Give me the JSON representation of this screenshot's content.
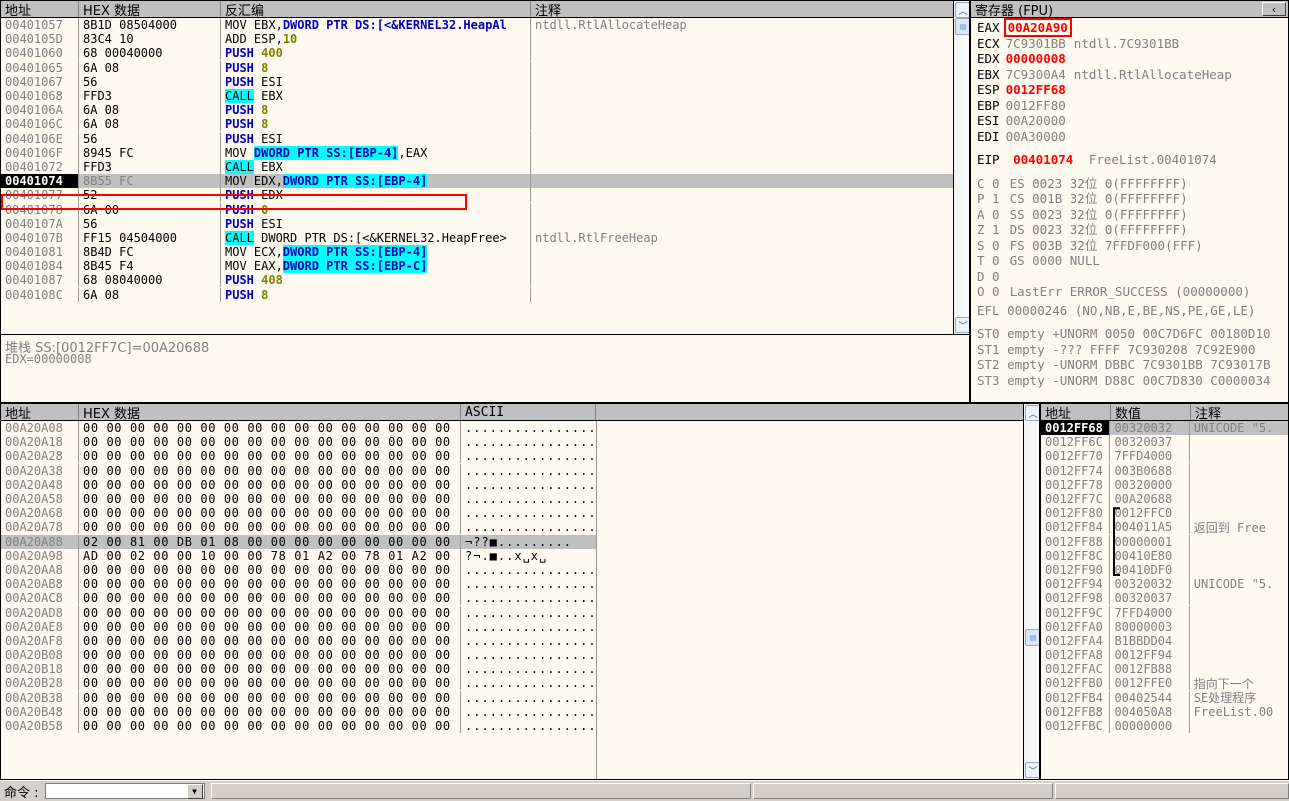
{
  "disassembly": {
    "headers": [
      "地址",
      "HEX 数据",
      "反汇编",
      "注释"
    ],
    "rows": [
      {
        "addr": "00401057",
        "hex": "8B1D 08504000",
        "dis": [
          {
            "t": "MOV ",
            "c": "mn-black"
          },
          {
            "t": "EBX,",
            "c": "mn-black"
          },
          {
            "t": "DWORD PTR DS:[<&KERNEL32.HeapAl",
            "c": "op-dkblue"
          }
        ],
        "cmt": "ntdll.RtlAllocateHeap"
      },
      {
        "addr": "0040105D",
        "hex": "83C4 10",
        "dis": [
          {
            "t": "ADD ",
            "c": "mn-black"
          },
          {
            "t": "ESP,",
            "c": "mn-black"
          },
          {
            "t": "10",
            "c": "num-olive"
          }
        ],
        "cmt": ""
      },
      {
        "addr": "00401060",
        "hex": "68 00040000",
        "dis": [
          {
            "t": "PUSH ",
            "c": "mn-blue"
          },
          {
            "t": "400",
            "c": "num-olive"
          }
        ],
        "cmt": ""
      },
      {
        "addr": "00401065",
        "hex": "6A 08",
        "dis": [
          {
            "t": "PUSH ",
            "c": "mn-blue"
          },
          {
            "t": "8",
            "c": "num-olive"
          }
        ],
        "cmt": ""
      },
      {
        "addr": "00401067",
        "hex": "56",
        "dis": [
          {
            "t": "PUSH ",
            "c": "mn-blue"
          },
          {
            "t": "ESI",
            "c": "mn-black"
          }
        ],
        "cmt": ""
      },
      {
        "addr": "00401068",
        "hex": "FFD3",
        "dis": [
          {
            "t": "CALL",
            "c": "cyan"
          },
          {
            "t": " EBX",
            "c": "mn-black"
          }
        ],
        "cmt": ""
      },
      {
        "addr": "0040106A",
        "hex": "6A 08",
        "dis": [
          {
            "t": "PUSH ",
            "c": "mn-blue"
          },
          {
            "t": "8",
            "c": "num-olive"
          }
        ],
        "cmt": ""
      },
      {
        "addr": "0040106C",
        "hex": "6A 08",
        "dis": [
          {
            "t": "PUSH ",
            "c": "mn-blue"
          },
          {
            "t": "8",
            "c": "num-olive"
          }
        ],
        "cmt": ""
      },
      {
        "addr": "0040106E",
        "hex": "56",
        "dis": [
          {
            "t": "PUSH ",
            "c": "mn-blue"
          },
          {
            "t": "ESI",
            "c": "mn-black"
          }
        ],
        "cmt": ""
      },
      {
        "addr": "0040106F",
        "hex": "8945 FC",
        "dis": [
          {
            "t": "MOV ",
            "c": "mn-black"
          },
          {
            "t": "DWORD PTR SS:[EBP-4]",
            "c": "cyan-b"
          },
          {
            "t": ",EAX",
            "c": "mn-black"
          }
        ],
        "cmt": ""
      },
      {
        "addr": "00401072",
        "hex": "FFD3",
        "dis": [
          {
            "t": "CALL",
            "c": "cyan"
          },
          {
            "t": " EBX",
            "c": "mn-black"
          }
        ],
        "cmt": ""
      },
      {
        "addr": "00401074",
        "hex": "8B55 FC",
        "dis": [
          {
            "t": "MOV EDX,",
            "c": "mn-black"
          },
          {
            "t": "DWORD PTR SS:[EBP-4]",
            "c": "cyan-b"
          }
        ],
        "cmt": "",
        "current": true
      },
      {
        "addr": "00401077",
        "hex": "52",
        "dis": [
          {
            "t": "PUSH ",
            "c": "mn-blue"
          },
          {
            "t": "EDX",
            "c": "mn-black"
          }
        ],
        "cmt": ""
      },
      {
        "addr": "00401078",
        "hex": "6A 00",
        "dis": [
          {
            "t": "PUSH ",
            "c": "mn-blue"
          },
          {
            "t": "0",
            "c": "num-olive"
          }
        ],
        "cmt": ""
      },
      {
        "addr": "0040107A",
        "hex": "56",
        "dis": [
          {
            "t": "PUSH ",
            "c": "mn-blue"
          },
          {
            "t": "ESI",
            "c": "mn-black"
          }
        ],
        "cmt": ""
      },
      {
        "addr": "0040107B",
        "hex": "FF15 04504000",
        "dis": [
          {
            "t": "CALL",
            "c": "cyan"
          },
          {
            "t": " DWORD PTR DS:[<&KERNEL32.HeapFree>",
            "c": "mn-black"
          }
        ],
        "cmt": "ntdll.RtlFreeHeap"
      },
      {
        "addr": "00401081",
        "hex": "8B4D FC",
        "dis": [
          {
            "t": "MOV ECX,",
            "c": "mn-black"
          },
          {
            "t": "DWORD PTR SS:[EBP-4]",
            "c": "cyan-b"
          }
        ],
        "cmt": ""
      },
      {
        "addr": "00401084",
        "hex": "8B45 F4",
        "dis": [
          {
            "t": "MOV EAX,",
            "c": "mn-black"
          },
          {
            "t": "DWORD PTR SS:[EBP-C]",
            "c": "cyan-b"
          }
        ],
        "cmt": ""
      },
      {
        "addr": "00401087",
        "hex": "68 08040000",
        "dis": [
          {
            "t": "PUSH ",
            "c": "mn-blue"
          },
          {
            "t": "408",
            "c": "num-olive"
          }
        ],
        "cmt": ""
      },
      {
        "addr": "0040108C",
        "hex": "6A 08",
        "dis": [
          {
            "t": "PUSH ",
            "c": "mn-blue"
          },
          {
            "t": "8",
            "c": "num-olive"
          }
        ],
        "cmt": ""
      }
    ]
  },
  "stack_info": {
    "line1": "堆栈 SS:[0012FF7C]=00A20688",
    "line2": "EDX=00000008"
  },
  "registers": {
    "title": "寄存器 (FPU)",
    "collapse_icon": "‹",
    "gpr": [
      {
        "name": "EAX",
        "value": "00A20A90",
        "cmt": "",
        "hl": true,
        "red": true
      },
      {
        "name": "ECX",
        "value": "7C9301BB",
        "cmt": "ntdll.7C9301BB",
        "red": false
      },
      {
        "name": "EDX",
        "value": "00000008",
        "cmt": "",
        "red": true
      },
      {
        "name": "EBX",
        "value": "7C9300A4",
        "cmt": "ntdll.RtlAllocateHeap",
        "red": false
      },
      {
        "name": "ESP",
        "value": "0012FF68",
        "cmt": "",
        "red": true
      },
      {
        "name": "EBP",
        "value": "0012FF80",
        "cmt": "",
        "red": false
      },
      {
        "name": "ESI",
        "value": "00A20000",
        "cmt": "",
        "red": false
      },
      {
        "name": "EDI",
        "value": "00A30000",
        "cmt": "",
        "red": false
      }
    ],
    "eip": {
      "name": "EIP",
      "value": "00401074",
      "cmt": "FreeList.00401074"
    },
    "flags": [
      {
        "f": "C",
        "v": "0",
        "seg": "ES",
        "sval": "0023",
        "desc": "32位  0(FFFFFFFF)"
      },
      {
        "f": "P",
        "v": "1",
        "seg": "CS",
        "sval": "001B",
        "desc": "32位  0(FFFFFFFF)"
      },
      {
        "f": "A",
        "v": "0",
        "seg": "SS",
        "sval": "0023",
        "desc": "32位  0(FFFFFFFF)"
      },
      {
        "f": "Z",
        "v": "1",
        "seg": "DS",
        "sval": "0023",
        "desc": "32位  0(FFFFFFFF)"
      },
      {
        "f": "S",
        "v": "0",
        "seg": "FS",
        "sval": "003B",
        "desc": "32位  7FFDF000(FFF)"
      },
      {
        "f": "T",
        "v": "0",
        "seg": "GS",
        "sval": "0000",
        "desc": "NULL"
      },
      {
        "f": "D",
        "v": "0",
        "seg": "",
        "sval": "",
        "desc": ""
      },
      {
        "f": "O",
        "v": "0",
        "seg": "",
        "sval": "",
        "desc": "LastErr ERROR_SUCCESS (00000000)"
      }
    ],
    "efl": "EFL 00000246 (NO,NB,E,BE,NS,PE,GE,LE)",
    "fpu": [
      "ST0 empty +UNORM 0050 00C7D6FC 00180D10",
      "ST1 empty -??? FFFF 7C930208 7C92E900",
      "ST2 empty -UNORM DBBC 7C9301BB 7C93017B",
      "ST3 empty -UNORM D88C 00C7D830 C0000034"
    ]
  },
  "dump": {
    "headers": [
      "地址",
      "HEX 数据",
      "ASCII",
      ""
    ],
    "rows": [
      {
        "addr": "00A20A08",
        "bytes": "00 00 00 00 00 00 00 00 00 00 00 00 00 00 00 00",
        "ascii": "................"
      },
      {
        "addr": "00A20A18",
        "bytes": "00 00 00 00 00 00 00 00 00 00 00 00 00 00 00 00",
        "ascii": "................"
      },
      {
        "addr": "00A20A28",
        "bytes": "00 00 00 00 00 00 00 00 00 00 00 00 00 00 00 00",
        "ascii": "................"
      },
      {
        "addr": "00A20A38",
        "bytes": "00 00 00 00 00 00 00 00 00 00 00 00 00 00 00 00",
        "ascii": "................"
      },
      {
        "addr": "00A20A48",
        "bytes": "00 00 00 00 00 00 00 00 00 00 00 00 00 00 00 00",
        "ascii": "................"
      },
      {
        "addr": "00A20A58",
        "bytes": "00 00 00 00 00 00 00 00 00 00 00 00 00 00 00 00",
        "ascii": "................"
      },
      {
        "addr": "00A20A68",
        "bytes": "00 00 00 00 00 00 00 00 00 00 00 00 00 00 00 00",
        "ascii": "................"
      },
      {
        "addr": "00A20A78",
        "bytes": "00 00 00 00 00 00 00 00 00 00 00 00 00 00 00 00",
        "ascii": "................"
      },
      {
        "addr": "00A20A88",
        "bytes": "02 00 81 00 DB 01 08 00 00 00 00 00 00 00 00 00",
        "ascii": "¬??■.........",
        "selected": true
      },
      {
        "addr": "00A20A98",
        "bytes": "AD 00 02 00 00 10 00 00 78 01 A2 00 78 01 A2 00",
        "ascii": "?¬.■..x␣x␣"
      },
      {
        "addr": "00A20AA8",
        "bytes": "00 00 00 00 00 00 00 00 00 00 00 00 00 00 00 00",
        "ascii": "................"
      },
      {
        "addr": "00A20AB8",
        "bytes": "00 00 00 00 00 00 00 00 00 00 00 00 00 00 00 00",
        "ascii": "................"
      },
      {
        "addr": "00A20AC8",
        "bytes": "00 00 00 00 00 00 00 00 00 00 00 00 00 00 00 00",
        "ascii": "................"
      },
      {
        "addr": "00A20AD8",
        "bytes": "00 00 00 00 00 00 00 00 00 00 00 00 00 00 00 00",
        "ascii": "................"
      },
      {
        "addr": "00A20AE8",
        "bytes": "00 00 00 00 00 00 00 00 00 00 00 00 00 00 00 00",
        "ascii": "................"
      },
      {
        "addr": "00A20AF8",
        "bytes": "00 00 00 00 00 00 00 00 00 00 00 00 00 00 00 00",
        "ascii": "................"
      },
      {
        "addr": "00A20B08",
        "bytes": "00 00 00 00 00 00 00 00 00 00 00 00 00 00 00 00",
        "ascii": "................"
      },
      {
        "addr": "00A20B18",
        "bytes": "00 00 00 00 00 00 00 00 00 00 00 00 00 00 00 00",
        "ascii": "................"
      },
      {
        "addr": "00A20B28",
        "bytes": "00 00 00 00 00 00 00 00 00 00 00 00 00 00 00 00",
        "ascii": "................"
      },
      {
        "addr": "00A20B38",
        "bytes": "00 00 00 00 00 00 00 00 00 00 00 00 00 00 00 00",
        "ascii": "................"
      },
      {
        "addr": "00A20B48",
        "bytes": "00 00 00 00 00 00 00 00 00 00 00 00 00 00 00 00",
        "ascii": "................"
      },
      {
        "addr": "00A20B58",
        "bytes": "00 00 00 00 00 00 00 00 00 00 00 00 00 00 00 00",
        "ascii": "................"
      }
    ]
  },
  "stack": {
    "headers": [
      "地址",
      "数值",
      "注释"
    ],
    "rows": [
      {
        "addr": "0012FF68",
        "value": "00320032",
        "cmt": "UNICODE \"5.",
        "selected": true
      },
      {
        "addr": "0012FF6C",
        "value": "00320037",
        "cmt": ""
      },
      {
        "addr": "0012FF70",
        "value": "7FFD4000",
        "cmt": ""
      },
      {
        "addr": "0012FF74",
        "value": "003B0688",
        "cmt": ""
      },
      {
        "addr": "0012FF78",
        "value": "00320000",
        "cmt": ""
      },
      {
        "addr": "0012FF7C",
        "value": "00A20688",
        "cmt": ""
      },
      {
        "addr": "0012FF80",
        "value": "0012FFC0",
        "cmt": "",
        "brace_start": true
      },
      {
        "addr": "0012FF84",
        "value": "004011A5",
        "cmt": "返回到 Free"
      },
      {
        "addr": "0012FF88",
        "value": "00000001",
        "cmt": ""
      },
      {
        "addr": "0012FF8C",
        "value": "00410E80",
        "cmt": ""
      },
      {
        "addr": "0012FF90",
        "value": "00410DF0",
        "cmt": "",
        "brace_end": true
      },
      {
        "addr": "0012FF94",
        "value": "00320032",
        "cmt": "UNICODE \"5."
      },
      {
        "addr": "0012FF98",
        "value": "00320037",
        "cmt": ""
      },
      {
        "addr": "0012FF9C",
        "value": "7FFD4000",
        "cmt": ""
      },
      {
        "addr": "0012FFA0",
        "value": "80000003",
        "cmt": ""
      },
      {
        "addr": "0012FFA4",
        "value": "B1BBDD04",
        "cmt": ""
      },
      {
        "addr": "0012FFA8",
        "value": "0012FF94",
        "cmt": ""
      },
      {
        "addr": "0012FFAC",
        "value": "0012FB88",
        "cmt": ""
      },
      {
        "addr": "0012FFB0",
        "value": "0012FFE0",
        "cmt": "指向下一个"
      },
      {
        "addr": "0012FFB4",
        "value": "00402544",
        "cmt": "SE处理程序"
      },
      {
        "addr": "0012FFB8",
        "value": "004050A8",
        "cmt": "FreeList.00"
      },
      {
        "addr": "0012FFBC",
        "value": "00000000",
        "cmt": ""
      }
    ]
  },
  "command_bar": {
    "label": "命令 :",
    "input_value": "",
    "dropdown_icon": "▼"
  },
  "colors": {
    "highlight_cyan": "#00ffff",
    "annotation_red": "#ff0000",
    "pane_bg": "#fffaf0",
    "header_bg": "#c0c0c0",
    "selection_grey": "#c0c0c0"
  },
  "scroll": {
    "up_icon": "^",
    "down_icon": "v",
    "thumb_icon": "≡"
  }
}
